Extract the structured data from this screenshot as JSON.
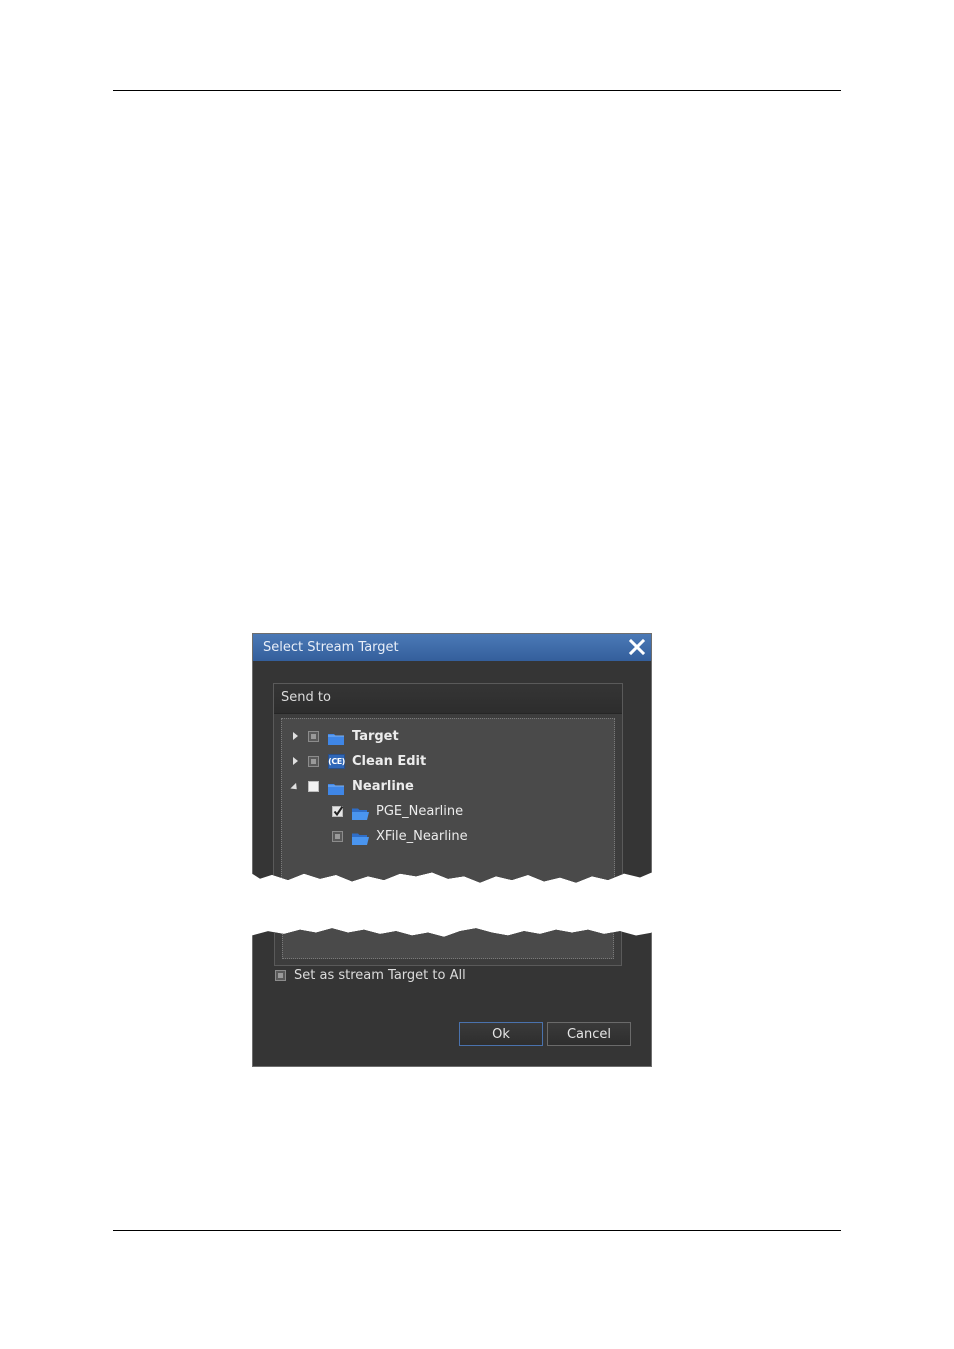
{
  "dialog": {
    "title": "Select Stream Target",
    "panel_header": "Send to",
    "tree": [
      {
        "label": "Target",
        "bold": true,
        "expander": "collapsed",
        "checkbox": "partial",
        "icon": "folder-icon"
      },
      {
        "label": "Clean Edit",
        "bold": true,
        "expander": "collapsed",
        "checkbox": "partial",
        "icon": "clean-edit-icon",
        "icon_text": "(CE)"
      },
      {
        "label": "Nearline",
        "bold": true,
        "expander": "expanded",
        "checkbox": "unchecked",
        "icon": "folder-icon"
      },
      {
        "label": "PGE_Nearline",
        "bold": false,
        "checkbox": "checked",
        "icon": "open-folder-icon"
      },
      {
        "label": "XFile_Nearline",
        "bold": false,
        "checkbox": "partial",
        "icon": "open-folder-icon"
      }
    ],
    "set_all_label": "Set as stream Target to All",
    "ok_label": "Ok",
    "cancel_label": "Cancel"
  },
  "colors": {
    "titlebar": "#3f6eae",
    "dialog_bg": "#353535",
    "tree_bg": "#4a4a4a",
    "folder_blue": "#3f86e6"
  }
}
